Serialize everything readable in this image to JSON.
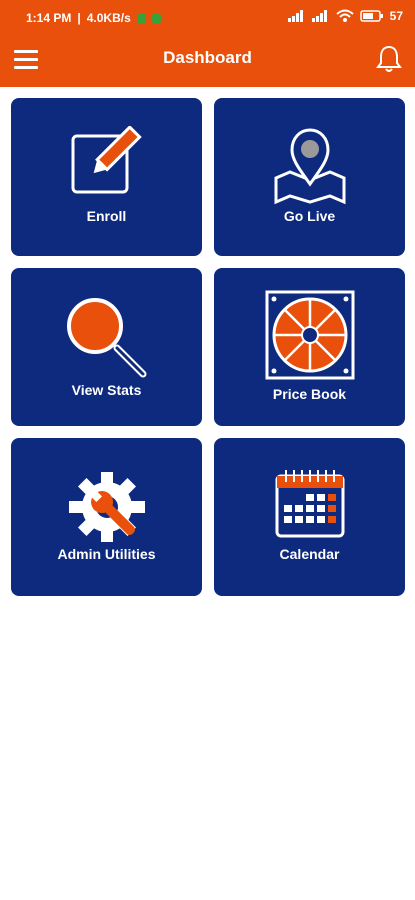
{
  "status": {
    "time": "1:14 PM",
    "network": "4.0KB/s",
    "battery": "57"
  },
  "header": {
    "title": "Dashboard"
  },
  "tiles": [
    {
      "label": "Enroll",
      "icon": "edit-icon"
    },
    {
      "label": "Go Live",
      "icon": "map-pin-icon"
    },
    {
      "label": "View Stats",
      "icon": "magnifier-icon"
    },
    {
      "label": "Price Book",
      "icon": "fan-icon"
    },
    {
      "label": "Admin Utilities",
      "icon": "wrench-gear-icon"
    },
    {
      "label": "Calendar",
      "icon": "calendar-icon"
    }
  ],
  "colors": {
    "brand": "#e8500b",
    "tile": "#0e2a7e",
    "background": "#ffffff"
  }
}
